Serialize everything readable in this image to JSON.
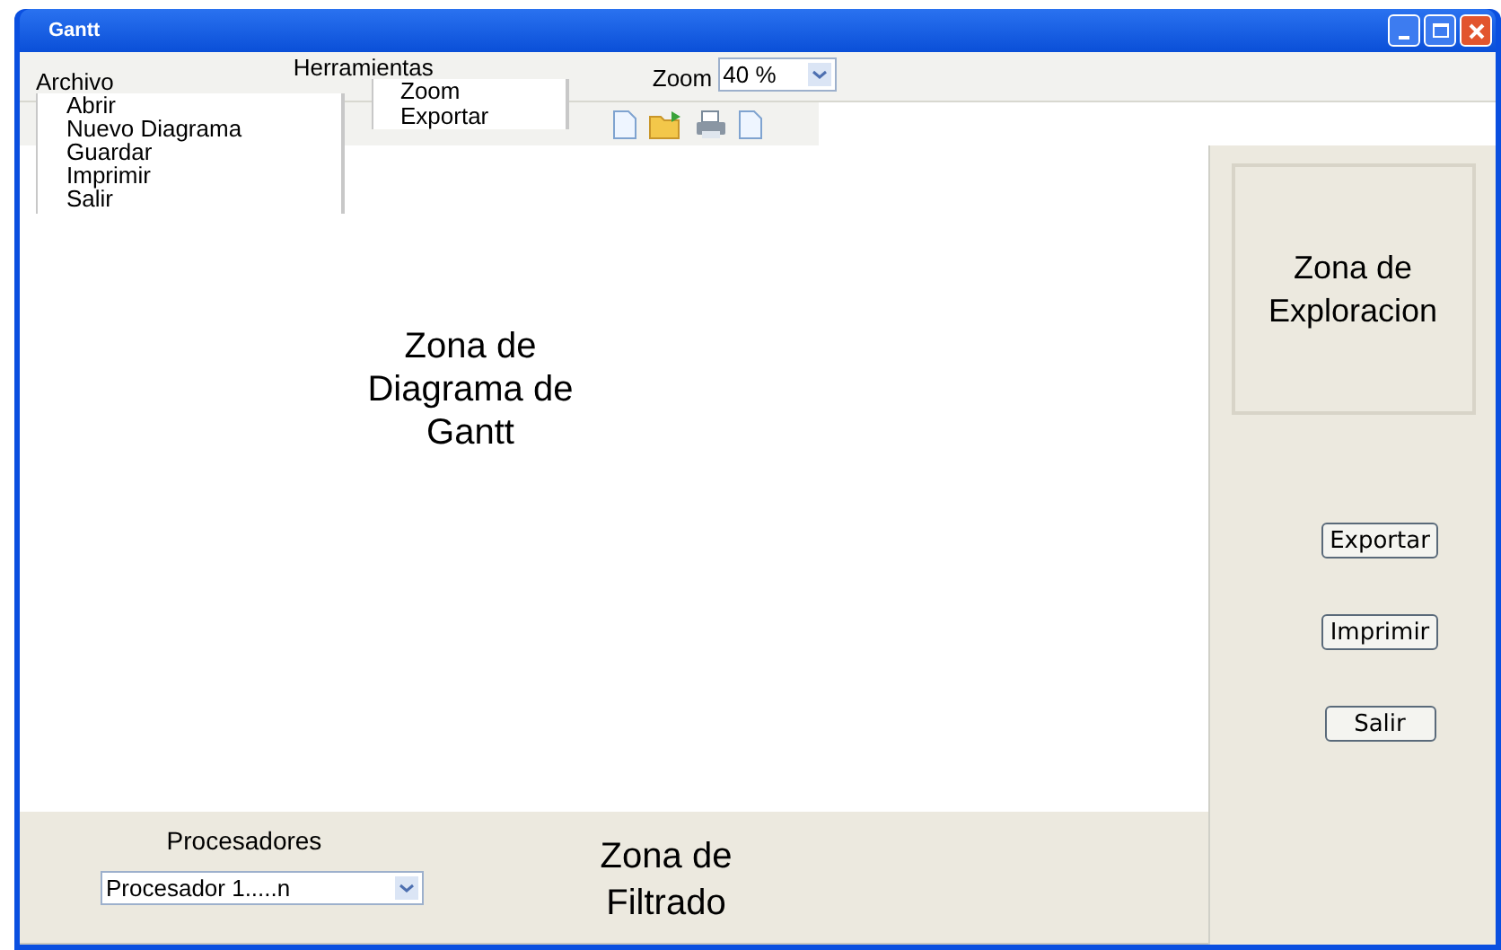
{
  "window": {
    "title": "Gantt"
  },
  "menus": [
    {
      "label": "Archivo",
      "items": [
        "Abrir",
        "Nuevo Diagrama",
        "Guardar",
        "Imprimir",
        "Salir"
      ]
    },
    {
      "label": "Herramientas",
      "items": [
        "Zoom",
        "Exportar"
      ]
    }
  ],
  "zoom": {
    "label": "Zoom",
    "value": "40 %"
  },
  "toolbar": [
    {
      "kind": "new"
    },
    {
      "kind": "open"
    },
    {
      "kind": "print"
    },
    {
      "kind": "page"
    }
  ],
  "diagram_zone": {
    "label": "Zona de Diagrama de Gantt"
  },
  "exploration_zone": {
    "label": "Zona de Exploracion"
  },
  "side_buttons": [
    "Exportar",
    "Imprimir",
    "Salir"
  ],
  "filter_zone": {
    "label": "Zona de Filtrado",
    "processors_label": "Procesadores",
    "processors_value": "Procesador 1.....n"
  }
}
